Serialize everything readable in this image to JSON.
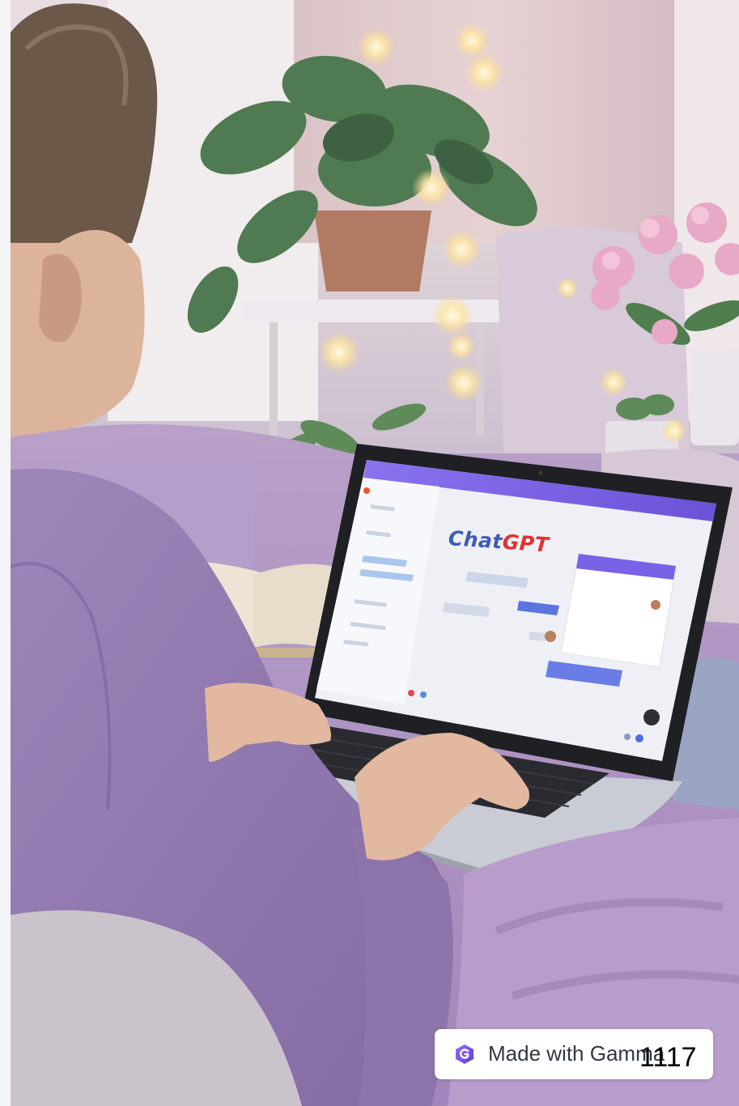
{
  "screen": {
    "logo_chat": "Chat",
    "logo_gpt": "GPT"
  },
  "badge": {
    "label": "Made with Gamma",
    "icon": "gamma-logo-icon"
  },
  "page_number": "1117",
  "colors": {
    "gamma_purple": "#7b5cf0",
    "chat_blue": "#3f5bb5",
    "gpt_red": "#e3312f",
    "screen_header": "#7a62e6"
  }
}
